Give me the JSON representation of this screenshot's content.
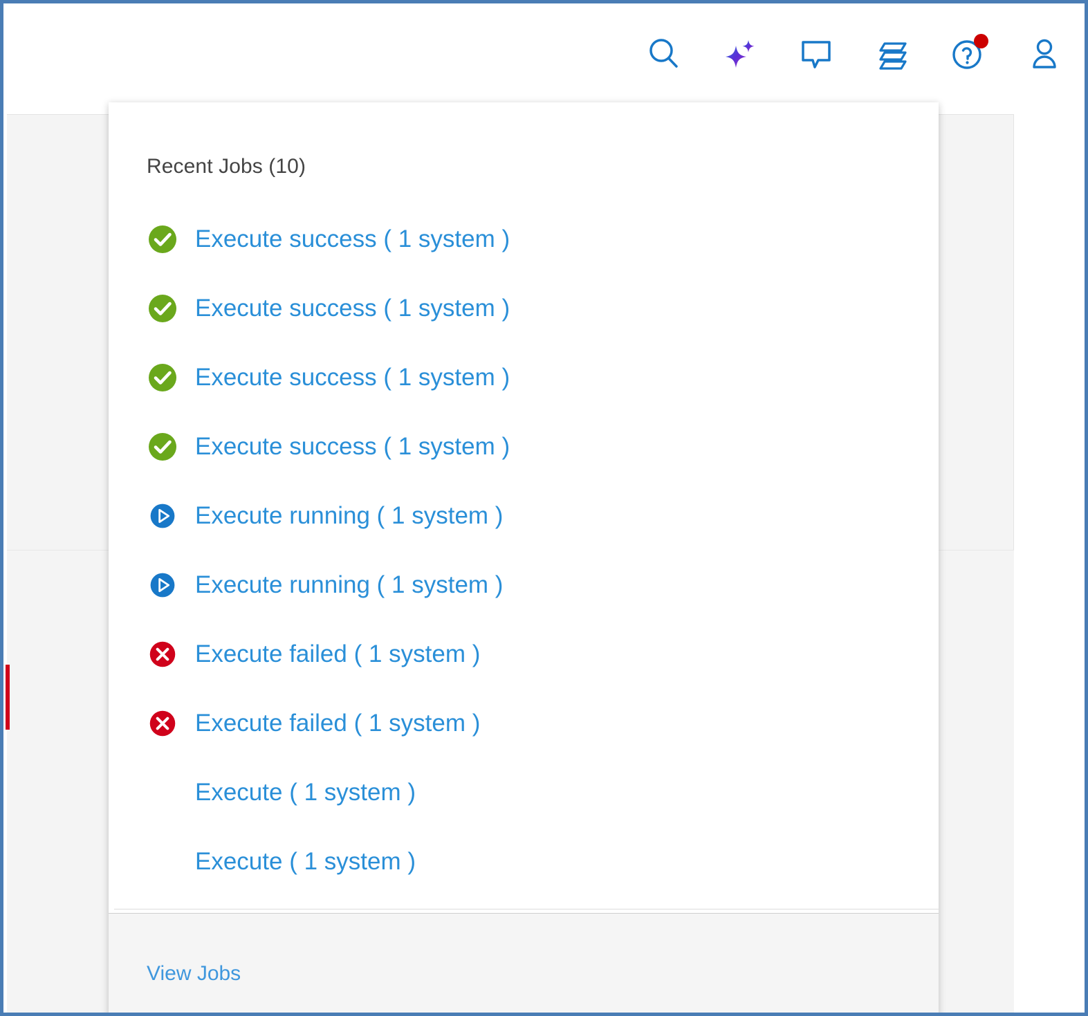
{
  "header": {
    "icons": [
      {
        "name": "search-icon",
        "label": "Search"
      },
      {
        "name": "ai-assistant-icon",
        "label": "AI Assistant"
      },
      {
        "name": "feedback-icon",
        "label": "Feedback"
      },
      {
        "name": "jobs-icon",
        "label": "Jobs"
      },
      {
        "name": "help-icon",
        "label": "Help",
        "badge": true
      },
      {
        "name": "user-account-icon",
        "label": "User Account"
      }
    ]
  },
  "dropdown": {
    "title": "Recent Jobs (10)",
    "jobs": [
      {
        "status": "success",
        "label": "Execute success ( 1 system )"
      },
      {
        "status": "success",
        "label": "Execute success ( 1 system )"
      },
      {
        "status": "success",
        "label": "Execute success ( 1 system )"
      },
      {
        "status": "success",
        "label": "Execute success ( 1 system )"
      },
      {
        "status": "running",
        "label": "Execute running ( 1 system )"
      },
      {
        "status": "running",
        "label": "Execute running ( 1 system )"
      },
      {
        "status": "failed",
        "label": "Execute failed ( 1 system )"
      },
      {
        "status": "failed",
        "label": "Execute failed ( 1 system )"
      },
      {
        "status": "none",
        "label": "Execute ( 1 system )"
      },
      {
        "status": "none",
        "label": "Execute ( 1 system )"
      }
    ],
    "footer": {
      "view_jobs_label": "View Jobs"
    }
  },
  "colors": {
    "link": "#2a8fd8",
    "success": "#6aa81c",
    "running": "#1878c8",
    "failed": "#d0021b",
    "badge": "#cc0000",
    "frame": "#4a7db5"
  }
}
